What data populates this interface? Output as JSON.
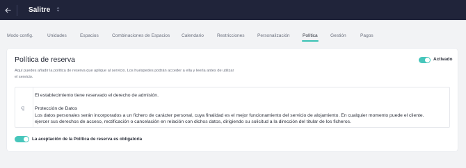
{
  "header": {
    "back_icon": "arrow-left-icon",
    "title": "Salitre",
    "chevron_icon": "chevron-updown-icon"
  },
  "tabs": [
    {
      "label": "Modo config.",
      "active": false
    },
    {
      "label": "Unidades",
      "active": false
    },
    {
      "label": "Espacios",
      "active": false
    },
    {
      "label": "Combinaciones de Espacios",
      "active": false
    },
    {
      "label": "Calendario",
      "active": false
    },
    {
      "label": "Restricciones",
      "active": false
    },
    {
      "label": "Personalización",
      "active": false
    },
    {
      "label": "Política",
      "active": true
    },
    {
      "label": "Gestión",
      "active": false
    },
    {
      "label": "Pagos",
      "active": false
    }
  ],
  "card": {
    "title": "Política de reserva",
    "enabled": true,
    "enabled_label": "Activado",
    "description": "Aquí puedes añadir la política de reserva que aplique al servicio. Los huéspedes podrán acceder a ella y leerla antes de utilizar el servicio.",
    "editor": {
      "paragraph_icon": "paragraph-icon",
      "lines": [
        "El establecimiento tiene reservado el derecho de admisión.",
        "",
        "Protección de Datos",
        "Los datos personales serán incorporados a un fichero de carácter personal, cuya finalidad es el mejor funcionamiento del servicio de alojamiento. En cualquier momento puede el cliente.",
        "ejercer sus derechos de acceso, rectificación o cancelación en relación con dichos datos, dirigiendo su solicitud a la dirección del titular de los ficheros."
      ]
    },
    "mandatory_enabled": true,
    "mandatory_label": "La aceptación de la Política de reserva es obligatoria"
  },
  "colors": {
    "topbar": "#20243a",
    "accent": "#47c6bb",
    "background": "#f2f3f5"
  }
}
